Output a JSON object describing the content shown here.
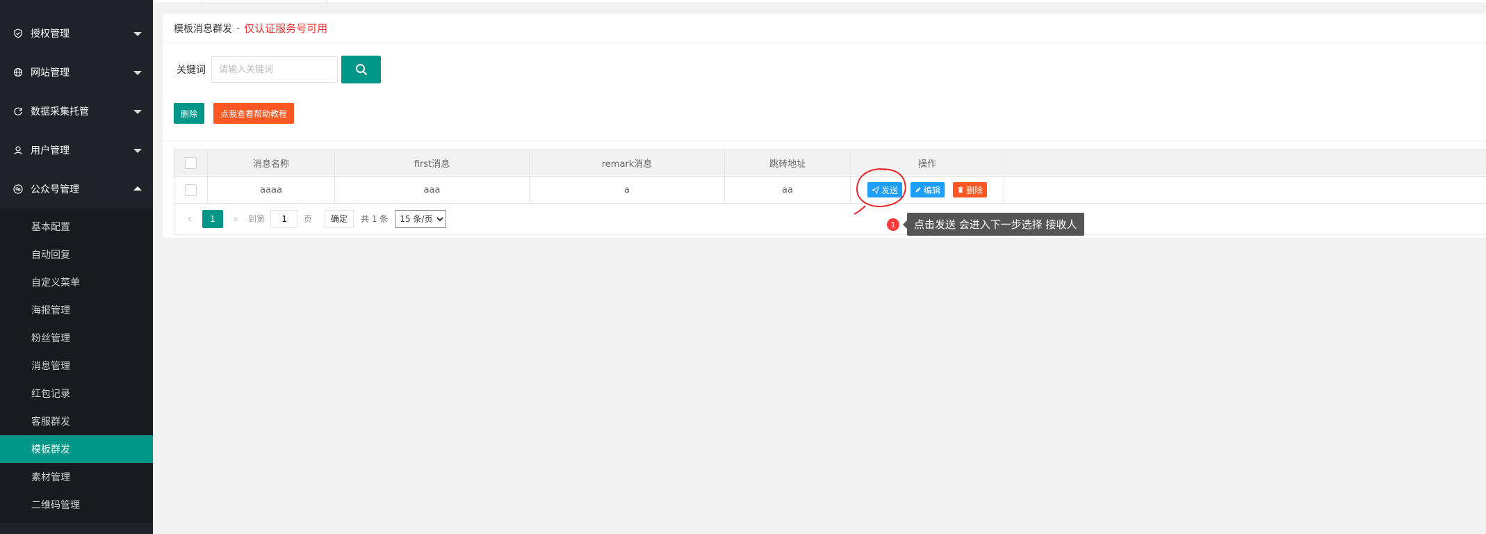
{
  "sidebar": {
    "groups": [
      {
        "label": "授权管理",
        "icon": "shield-check-icon",
        "expanded": false
      },
      {
        "label": "网站管理",
        "icon": "globe-icon",
        "expanded": false
      },
      {
        "label": "数据采集托管",
        "icon": "refresh-icon",
        "expanded": false
      },
      {
        "label": "用户管理",
        "icon": "user-icon",
        "expanded": false
      },
      {
        "label": "公众号管理",
        "icon": "wechat-icon",
        "expanded": true
      }
    ],
    "subitems": [
      "基本配置",
      "自动回复",
      "自定义菜单",
      "海报管理",
      "粉丝管理",
      "消息管理",
      "红包记录",
      "客服群发",
      "模板群发",
      "素材管理",
      "二维码管理"
    ],
    "active_subitem": "模板群发"
  },
  "header": {
    "title": "模板消息群发",
    "separator": "-",
    "warning": "仅认证服务号可用"
  },
  "search": {
    "label": "关键词",
    "placeholder": "请输入关键词"
  },
  "toolbar": {
    "delete_label": "删除",
    "help_label": "点我查看帮助教程"
  },
  "table": {
    "columns": [
      "消息名称",
      "first消息",
      "remark消息",
      "跳转地址",
      "操作"
    ],
    "rows": [
      {
        "name": "aaaa",
        "first": "aaa",
        "remark": "a",
        "url": "aa"
      }
    ],
    "actions": {
      "send": "发送",
      "edit": "编辑",
      "delete": "删除"
    }
  },
  "pagination": {
    "current_page": "1",
    "goto_label": "到第",
    "goto_value": "1",
    "page_unit": "页",
    "confirm_label": "确定",
    "total_label": "共 1 条",
    "page_size": "15 条/页"
  },
  "annotation": {
    "badge": "1",
    "tooltip": "点击发送 会进入下一步选择 接收人"
  },
  "colors": {
    "sidebar_bg": "#20222a",
    "submenu_bg": "#181a1f",
    "primary": "#009688",
    "warning_text": "#ff2d2d",
    "orange": "#ff5722",
    "blue": "#1e9fff"
  }
}
